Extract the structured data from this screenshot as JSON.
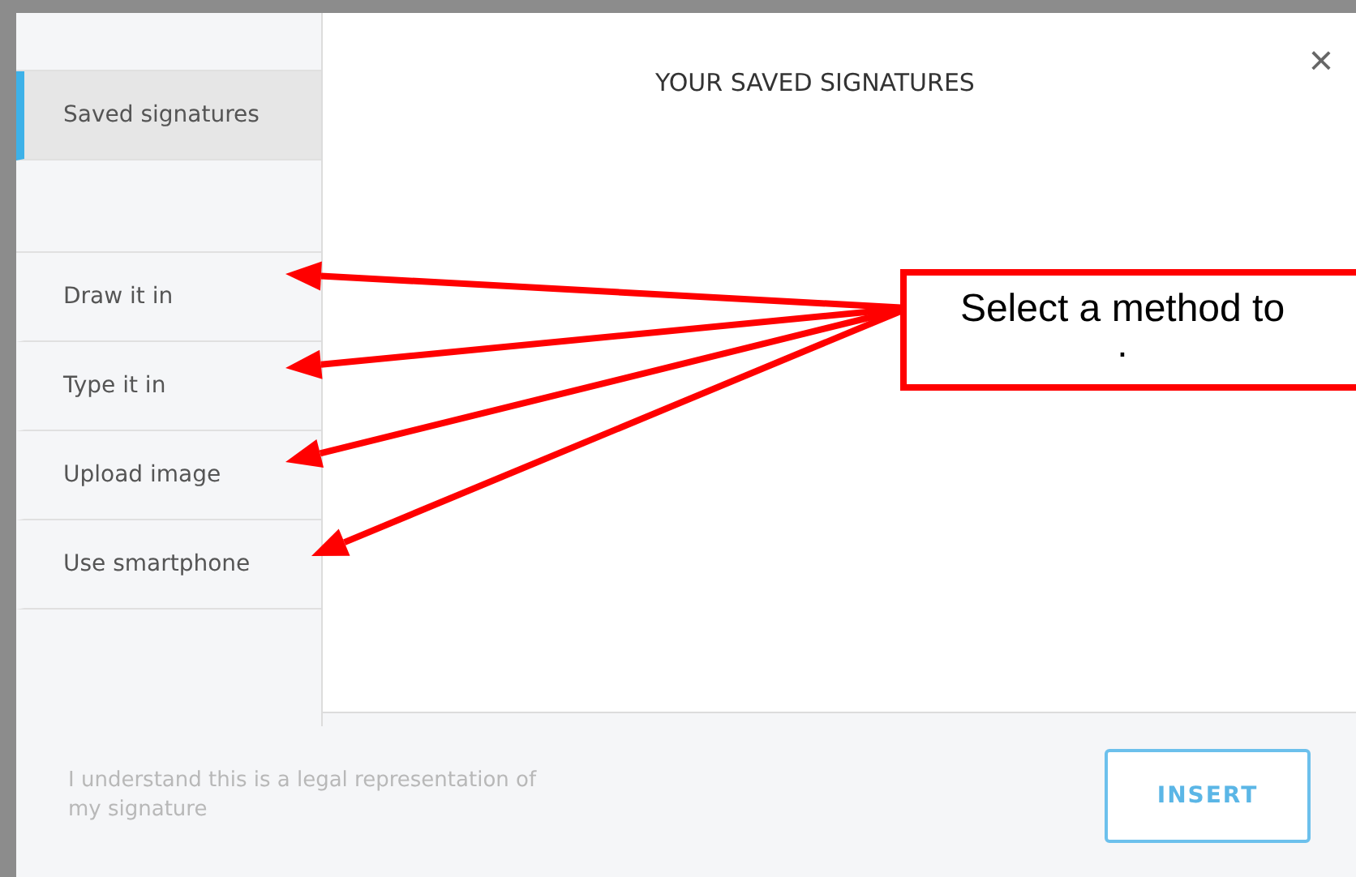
{
  "sidebar": {
    "groups": [
      {
        "items": [
          {
            "label": "Saved signatures",
            "selected": true
          }
        ]
      },
      {
        "items": [
          {
            "label": "Draw it in",
            "selected": false
          },
          {
            "label": "Type it in",
            "selected": false
          },
          {
            "label": "Upload image",
            "selected": false
          },
          {
            "label": "Use smartphone",
            "selected": false
          }
        ]
      }
    ]
  },
  "panel": {
    "title": "YOUR SAVED SIGNATURES",
    "close": "×"
  },
  "footer": {
    "notice": "I understand this is a legal representation of my signature",
    "button": "INSERT"
  },
  "callout": {
    "lines": [
      "Select a method to",
      "."
    ]
  }
}
